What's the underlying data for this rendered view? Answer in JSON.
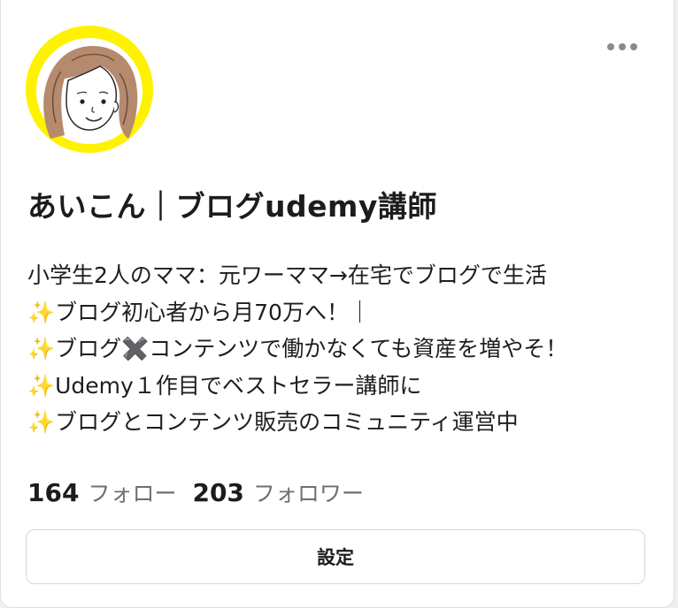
{
  "profile": {
    "display_name": "あいこん｜ブログudemy講師",
    "avatar_icon": "illustrated-woman-avatar",
    "avatar_ring_color": "#fff200",
    "bio_lines": [
      "小学生2人のママ：元ワーママ→在宅でブログで生活",
      "✨ブログ初心者から月70万へ！｜",
      "✨ブログ✖️コンテンツで働かなくても資産を増やそ！",
      "✨Udemy１作目でベストセラー講師に",
      "✨ブログとコンテンツ販売のコミュニティ運営中"
    ]
  },
  "stats": {
    "following_count": "164",
    "following_label": "フォロー",
    "followers_count": "203",
    "followers_label": "フォロワー"
  },
  "actions": {
    "more_icon": "more-horizontal-icon",
    "settings_label": "設定"
  }
}
